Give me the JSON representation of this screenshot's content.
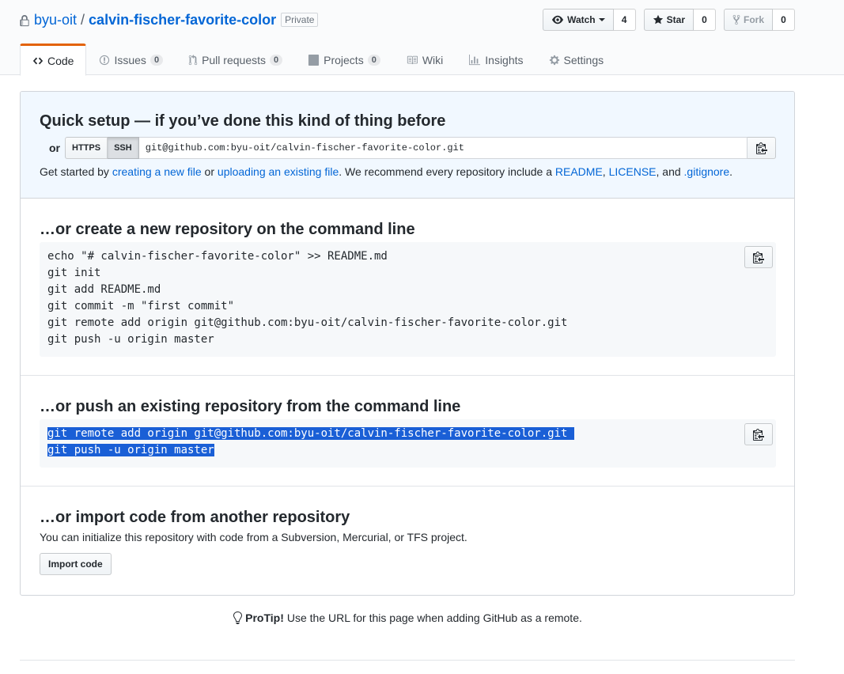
{
  "repo": {
    "owner": "byu-oit",
    "separator": "/",
    "name": "calvin-fischer-favorite-color",
    "visibility_label": "Private"
  },
  "actions": {
    "watch_label": "Watch",
    "watch_count": "4",
    "star_label": "Star",
    "star_count": "0",
    "fork_label": "Fork",
    "fork_count": "0"
  },
  "nav": {
    "code": "Code",
    "issues": "Issues",
    "issues_count": "0",
    "pulls": "Pull requests",
    "pulls_count": "0",
    "projects": "Projects",
    "projects_count": "0",
    "wiki": "Wiki",
    "insights": "Insights",
    "settings": "Settings"
  },
  "quick_setup": {
    "title": "Quick setup — if you’ve done this kind of thing before",
    "or_label": "or",
    "https_label": "HTTPS",
    "ssh_label": "SSH",
    "clone_url": "git@github.com:byu-oit/calvin-fischer-favorite-color.git",
    "get_started_prefix": "Get started by ",
    "link_new_file": "creating a new file",
    "or_text": " or ",
    "link_upload": "uploading an existing file",
    "recommend_text": ". We recommend every repository include a ",
    "link_readme": "README",
    "comma": ", ",
    "link_license": "LICENSE",
    "and_text": ", and ",
    "link_gitignore": ".gitignore",
    "period": "."
  },
  "create_section": {
    "title": "…or create a new repository on the command line",
    "code": "echo \"# calvin-fischer-favorite-color\" >> README.md\ngit init\ngit add README.md\ngit commit -m \"first commit\"\ngit remote add origin git@github.com:byu-oit/calvin-fischer-favorite-color.git\ngit push -u origin master"
  },
  "push_section": {
    "title": "…or push an existing repository from the command line",
    "line1": "git remote add origin git@github.com:byu-oit/calvin-fischer-favorite-color.git ",
    "line2": "git push -u origin master"
  },
  "import_section": {
    "title": "…or import code from another repository",
    "description": "You can initialize this repository with code from a Subversion, Mercurial, or TFS project.",
    "button_label": "Import code"
  },
  "protip": {
    "label": "ProTip!",
    "text": "Use the URL for this page when adding GitHub as a remote."
  },
  "colors": {
    "link": "#0366d6",
    "tab_accent": "#e36209",
    "selection": "#1a5fd6",
    "quick_setup_bg": "#f1f8ff"
  }
}
